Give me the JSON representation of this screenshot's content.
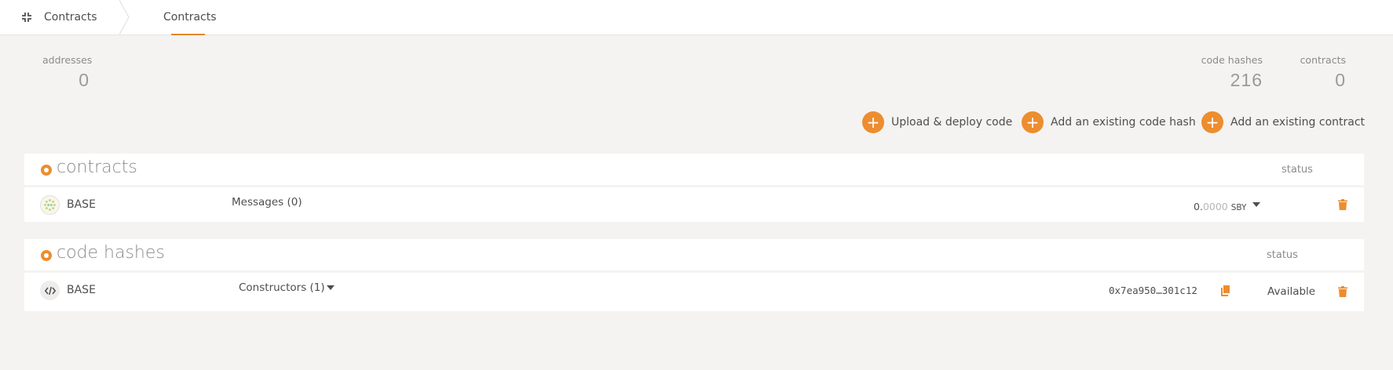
{
  "header": {
    "app_label": "Contracts",
    "app_icon": "collapse-arrows-icon",
    "tab_label": "Contracts"
  },
  "summary": {
    "addresses": {
      "label": "addresses",
      "value": "0"
    },
    "code_hashes": {
      "label": "code hashes",
      "value": "216"
    },
    "contracts": {
      "label": "contracts",
      "value": "0"
    }
  },
  "actions": {
    "upload": "Upload & deploy code",
    "add_code_hash": "Add an existing code hash",
    "add_contract": "Add an existing contract"
  },
  "contracts_table": {
    "title": "contracts",
    "status_header": "status",
    "row": {
      "name": "BASE",
      "messages": "Messages (0)",
      "balance_int": "0.",
      "balance_frac": "0000",
      "balance_unit": "SBY"
    }
  },
  "code_hashes_table": {
    "title": "code hashes",
    "status_header": "status",
    "row": {
      "name": "BASE",
      "constructors": "Constructors (1)",
      "hash": "0x7ea950…301c12",
      "status": "Available"
    }
  },
  "colors": {
    "accent": "#ec8d2f",
    "background": "#f4f3f1",
    "panel": "#ffffff",
    "muted_text": "#8c8b89"
  }
}
